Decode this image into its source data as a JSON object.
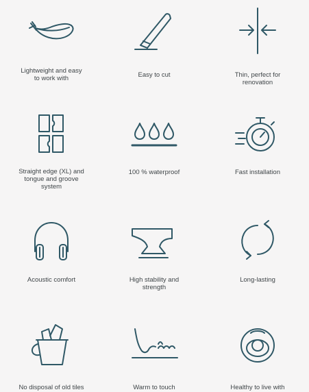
{
  "accent_color": "#2f5866",
  "features": [
    {
      "icon": "feather-icon",
      "label": "Lightweight and easy\nto work with"
    },
    {
      "icon": "cutter-knife-icon",
      "label": "Easy to cut"
    },
    {
      "icon": "arrows-inward-icon",
      "label": "Thin, perfect for\nrenovation"
    },
    {
      "icon": "tongue-and-groove-panels-icon",
      "label": "Straight edge (XL) and\ntongue and groove\nsystem"
    },
    {
      "icon": "water-drops-icon",
      "label": "100 % waterproof"
    },
    {
      "icon": "stopwatch-icon",
      "label": "Fast installation"
    },
    {
      "icon": "headphones-icon",
      "label": "Acoustic comfort"
    },
    {
      "icon": "anvil-icon",
      "label": "High stability and\nstrength"
    },
    {
      "icon": "circular-arrows-icon",
      "label": "Long-lasting"
    },
    {
      "icon": "bucket-icon",
      "label": "No disposal of old tiles"
    },
    {
      "icon": "warm-foot-icon",
      "label": "Warm to touch"
    },
    {
      "icon": "pacifier-icon",
      "label": "Healthy to live with"
    }
  ]
}
